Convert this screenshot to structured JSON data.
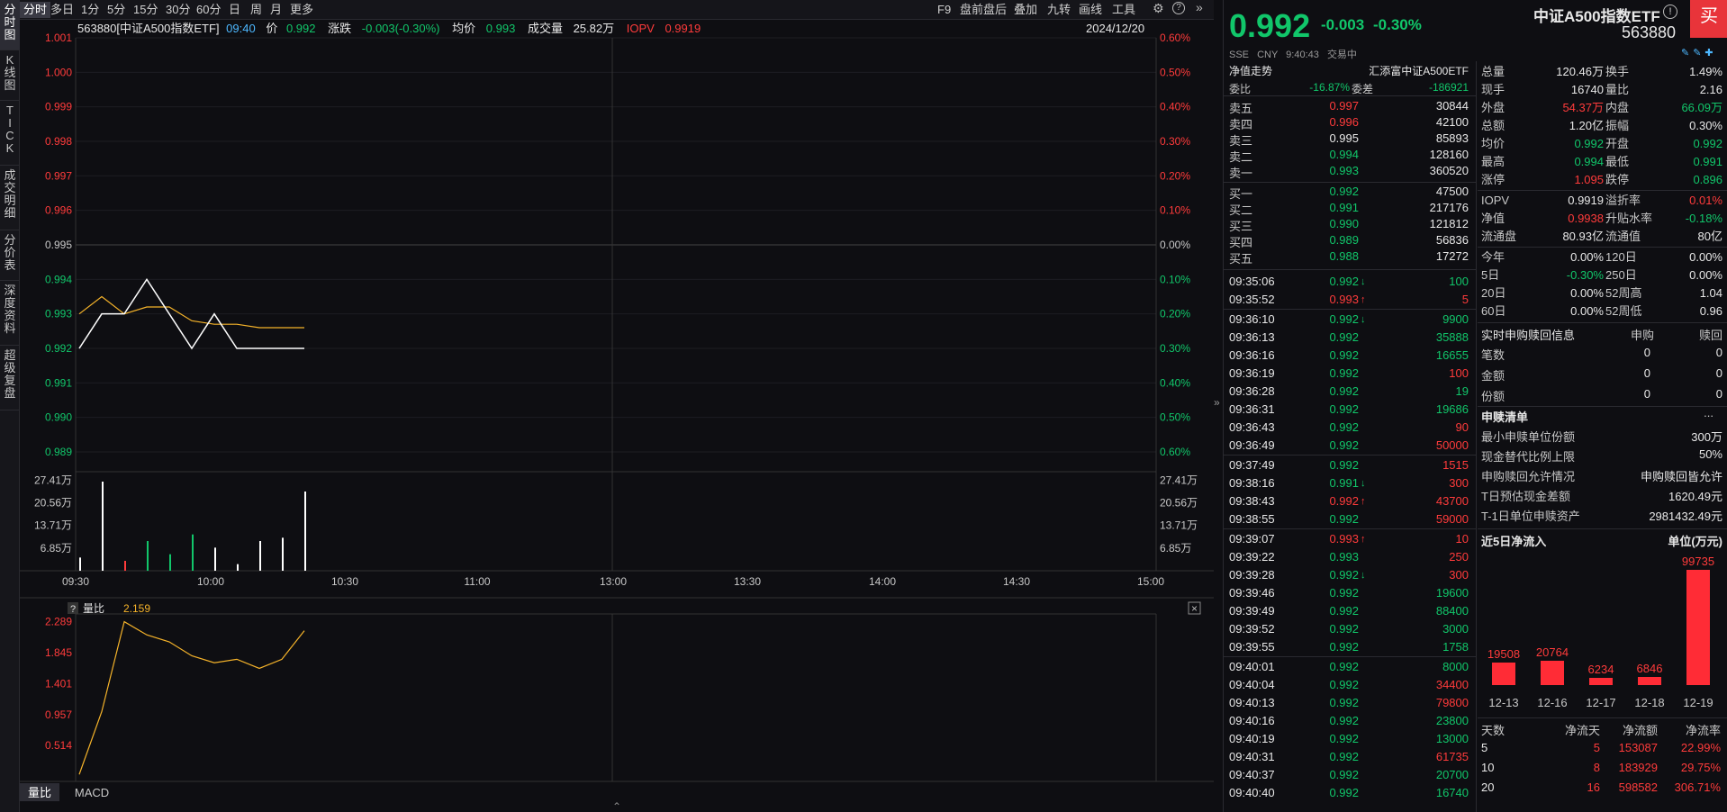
{
  "left_tabs": [
    "分\n时\n图",
    "K\n线\n图",
    "T\nI\nC\nK",
    "成\n交\n明\n细",
    "分\n价\n表",
    "深\n度\n资\n料",
    "超\n级\n复\n盘"
  ],
  "toolbar": {
    "periods": [
      "分时",
      "多日",
      "1分",
      "5分",
      "15分",
      "30分",
      "60分",
      "日",
      "周",
      "月",
      "更多"
    ],
    "right": [
      "F9",
      "盘前盘后",
      "叠加",
      "九转",
      "画线",
      "工具"
    ]
  },
  "info": {
    "code_name": "563880[中证A500指数ETF]",
    "time": "09:40",
    "price_label": "价",
    "price": "0.992",
    "change_label": "涨跌",
    "change": "-0.003(-0.30%)",
    "avg_label": "均价",
    "avg": "0.993",
    "vol_label": "成交量",
    "vol": "25.82万",
    "iopv_label": "IOPV",
    "iopv": "0.9919",
    "date": "2024/12/20"
  },
  "price_axis": {
    "left": [
      "1.001",
      "1.000",
      "0.999",
      "0.998",
      "0.997",
      "0.996",
      "0.995",
      "0.994",
      "0.993",
      "0.992",
      "0.991",
      "0.990",
      "0.989"
    ],
    "right": [
      "0.60%",
      "0.50%",
      "0.40%",
      "0.30%",
      "0.20%",
      "0.10%",
      "0.00%",
      "0.10%",
      "0.20%",
      "0.30%",
      "0.40%",
      "0.50%",
      "0.60%"
    ],
    "vol_left": [
      "27.41万",
      "20.56万",
      "13.71万",
      "6.85万"
    ],
    "vol_right": [
      "27.41万",
      "20.56万",
      "13.71万",
      "6.85万"
    ],
    "time": [
      "09:30",
      "10:00",
      "10:30",
      "11:00",
      "13:00",
      "13:30",
      "14:00",
      "14:30",
      "15:00"
    ]
  },
  "sub_chart": {
    "help": "?",
    "label": "量比",
    "value": "2.159",
    "axis": [
      "2.289",
      "1.845",
      "1.401",
      "0.957",
      "0.514"
    ],
    "tabs": [
      "量比",
      "MACD"
    ]
  },
  "chart_data": [
    {
      "type": "line",
      "title": "",
      "x": [
        "09:30",
        "09:31",
        "09:32",
        "09:33",
        "09:34",
        "09:35",
        "09:36",
        "09:37",
        "09:38",
        "09:39",
        "09:40"
      ],
      "series": [
        {
          "values": [
            0.992,
            0.993,
            0.993,
            0.994,
            0.993,
            0.992,
            0.993,
            0.992,
            0.992,
            0.992,
            0.992
          ]
        },
        {
          "values": [
            0.993,
            0.9935,
            0.993,
            0.9932,
            0.9932,
            0.9928,
            0.9927,
            0.9927,
            0.9926,
            0.9926,
            0.9926
          ]
        }
      ],
      "ylim": [
        0.989,
        1.001
      ]
    },
    {
      "type": "bar",
      "title": "",
      "x": [
        "09:30",
        "09:31",
        "09:32",
        "09:33",
        "09:34",
        "09:35",
        "09:36",
        "09:37",
        "09:38",
        "09:39",
        "09:40"
      ],
      "values": [
        4,
        27,
        3,
        9,
        5,
        11,
        7,
        2,
        9,
        10,
        24
      ],
      "ylim": [
        0,
        30
      ]
    },
    {
      "type": "line",
      "title": "",
      "x": [
        "09:30",
        "09:31",
        "09:32",
        "09:33",
        "09:34",
        "09:35",
        "09:36",
        "09:37",
        "09:38",
        "09:39",
        "09:40"
      ],
      "values": [
        0.1,
        1.0,
        2.289,
        2.1,
        2.0,
        1.8,
        1.7,
        1.75,
        1.62,
        1.75,
        2.159
      ],
      "ylim": [
        0,
        2.4
      ]
    },
    {
      "type": "bar",
      "title": "近5日净流入",
      "ylabel": "单位(万元)",
      "categories": [
        "12-13",
        "12-16",
        "12-17",
        "12-18",
        "12-19"
      ],
      "values": [
        19508,
        20764,
        6234,
        6846,
        99735
      ]
    }
  ],
  "header": {
    "price": "0.992",
    "change": "-0.003",
    "pct": "-0.30%",
    "name": "中证A500指数ETF",
    "code": "563880",
    "exchange": "SSE",
    "currency": "CNY",
    "time": "9:40:43",
    "status": "交易中",
    "buy": "买"
  },
  "quote": {
    "nav_label": "净值走势",
    "fund_name": "汇添富中证A500ETF",
    "weibi_label": "委比",
    "weibi": "-16.87%",
    "weicha_label": "委差",
    "weicha": "-186921",
    "asks": [
      {
        "label": "卖五",
        "price": "0.997",
        "vol": "30844",
        "cls": "red"
      },
      {
        "label": "卖四",
        "price": "0.996",
        "vol": "42100",
        "cls": "red"
      },
      {
        "label": "卖三",
        "price": "0.995",
        "vol": "85893",
        "cls": "white"
      },
      {
        "label": "卖二",
        "price": "0.994",
        "vol": "128160",
        "cls": "green"
      },
      {
        "label": "卖一",
        "price": "0.993",
        "vol": "360520",
        "cls": "green"
      }
    ],
    "bids": [
      {
        "label": "买一",
        "price": "0.992",
        "vol": "47500",
        "cls": "green"
      },
      {
        "label": "买二",
        "price": "0.991",
        "vol": "217176",
        "cls": "green"
      },
      {
        "label": "买三",
        "price": "0.990",
        "vol": "121812",
        "cls": "green"
      },
      {
        "label": "买四",
        "price": "0.989",
        "vol": "56836",
        "cls": "green"
      },
      {
        "label": "买五",
        "price": "0.988",
        "vol": "17272",
        "cls": "green"
      }
    ]
  },
  "ticks": [
    {
      "t": "09:35:06",
      "p": "0.992",
      "a": "down",
      "v": "100",
      "c": "green"
    },
    {
      "t": "09:35:52",
      "p": "0.993",
      "a": "up",
      "v": "5",
      "c": "red"
    },
    {
      "t": "09:36:10",
      "p": "0.992",
      "a": "down",
      "v": "9900",
      "c": "green"
    },
    {
      "t": "09:36:13",
      "p": "0.992",
      "a": "",
      "v": "35888",
      "c": "green"
    },
    {
      "t": "09:36:16",
      "p": "0.992",
      "a": "",
      "v": "16655",
      "c": "green"
    },
    {
      "t": "09:36:19",
      "p": "0.992",
      "a": "",
      "v": "100",
      "c": "red"
    },
    {
      "t": "09:36:28",
      "p": "0.992",
      "a": "",
      "v": "19",
      "c": "green"
    },
    {
      "t": "09:36:31",
      "p": "0.992",
      "a": "",
      "v": "19686",
      "c": "green"
    },
    {
      "t": "09:36:43",
      "p": "0.992",
      "a": "",
      "v": "90",
      "c": "red"
    },
    {
      "t": "09:36:49",
      "p": "0.992",
      "a": "",
      "v": "50000",
      "c": "red"
    },
    {
      "t": "09:37:49",
      "p": "0.992",
      "a": "",
      "v": "1515",
      "c": "red"
    },
    {
      "t": "09:38:16",
      "p": "0.991",
      "a": "down",
      "v": "300",
      "c": "red"
    },
    {
      "t": "09:38:43",
      "p": "0.992",
      "a": "up",
      "v": "43700",
      "c": "red"
    },
    {
      "t": "09:38:55",
      "p": "0.992",
      "a": "",
      "v": "59000",
      "c": "red"
    },
    {
      "t": "09:39:07",
      "p": "0.993",
      "a": "up",
      "v": "10",
      "c": "red"
    },
    {
      "t": "09:39:22",
      "p": "0.993",
      "a": "",
      "v": "250",
      "c": "red"
    },
    {
      "t": "09:39:28",
      "p": "0.992",
      "a": "down",
      "v": "300",
      "c": "red"
    },
    {
      "t": "09:39:46",
      "p": "0.992",
      "a": "",
      "v": "19600",
      "c": "green"
    },
    {
      "t": "09:39:49",
      "p": "0.992",
      "a": "",
      "v": "88400",
      "c": "green"
    },
    {
      "t": "09:39:52",
      "p": "0.992",
      "a": "",
      "v": "3000",
      "c": "green"
    },
    {
      "t": "09:39:55",
      "p": "0.992",
      "a": "",
      "v": "1758",
      "c": "green"
    },
    {
      "t": "09:40:01",
      "p": "0.992",
      "a": "",
      "v": "8000",
      "c": "green"
    },
    {
      "t": "09:40:04",
      "p": "0.992",
      "a": "",
      "v": "34400",
      "c": "red"
    },
    {
      "t": "09:40:13",
      "p": "0.992",
      "a": "",
      "v": "79800",
      "c": "red"
    },
    {
      "t": "09:40:16",
      "p": "0.992",
      "a": "",
      "v": "23800",
      "c": "green"
    },
    {
      "t": "09:40:19",
      "p": "0.992",
      "a": "",
      "v": "13000",
      "c": "green"
    },
    {
      "t": "09:40:31",
      "p": "0.992",
      "a": "",
      "v": "61735",
      "c": "red"
    },
    {
      "t": "09:40:37",
      "p": "0.992",
      "a": "",
      "v": "20700",
      "c": "green"
    },
    {
      "t": "09:40:40",
      "p": "0.992",
      "a": "",
      "v": "16740",
      "c": "green"
    }
  ],
  "stats": [
    [
      "总量",
      "120.46万",
      "white",
      "换手",
      "1.49%",
      "white"
    ],
    [
      "现手",
      "16740",
      "white",
      "量比",
      "2.16",
      "white"
    ],
    [
      "外盘",
      "54.37万",
      "red",
      "内盘",
      "66.09万",
      "green"
    ],
    [
      "总额",
      "1.20亿",
      "white",
      "振幅",
      "0.30%",
      "white"
    ],
    [
      "均价",
      "0.992",
      "green",
      "开盘",
      "0.992",
      "green"
    ],
    [
      "最高",
      "0.994",
      "green",
      "最低",
      "0.991",
      "green"
    ],
    [
      "涨停",
      "1.095",
      "red",
      "跌停",
      "0.896",
      "green"
    ],
    [
      "IOPV",
      "0.9919",
      "white",
      "溢折率",
      "0.01%",
      "red"
    ],
    [
      "净值",
      "0.9938",
      "red",
      "升贴水率",
      "-0.18%",
      "green"
    ],
    [
      "流通盘",
      "80.93亿",
      "white",
      "流通值",
      "80亿",
      "white"
    ],
    [
      "今年",
      "0.00%",
      "white",
      "120日",
      "0.00%",
      "white"
    ],
    [
      "5日",
      "-0.30%",
      "green",
      "250日",
      "0.00%",
      "white"
    ],
    [
      "20日",
      "0.00%",
      "white",
      "52周高",
      "1.04",
      "white"
    ],
    [
      "60日",
      "0.00%",
      "white",
      "52周低",
      "0.96",
      "white"
    ]
  ],
  "redeem": {
    "title": "实时申购赎回信息",
    "col1": "申购",
    "col2": "赎回",
    "rows": [
      [
        "笔数",
        "0",
        "0"
      ],
      [
        "金额",
        "0",
        "0"
      ],
      [
        "份额",
        "0",
        "0"
      ]
    ]
  },
  "sglist": {
    "title": "申赎清单",
    "more": "...",
    "rows": [
      [
        "最小申赎单位份额",
        "300万"
      ],
      [
        "现金替代比例上限",
        "50%"
      ],
      [
        "申购赎回允许情况",
        "申购赎回皆允许"
      ],
      [
        "T日预估现金差额",
        "1620.49元"
      ],
      [
        "T-1日单位申赎资产",
        "2981432.49元"
      ]
    ]
  },
  "flow": {
    "title": "近5日净流入",
    "unit": "单位(万元)"
  },
  "flow_table": {
    "head": [
      "天数",
      "净流天",
      "净流额",
      "净流率"
    ],
    "rows": [
      [
        "5",
        "5",
        "153087",
        "22.99%"
      ],
      [
        "10",
        "8",
        "183929",
        "29.75%"
      ],
      [
        "20",
        "16",
        "598582",
        "306.71%"
      ]
    ]
  }
}
